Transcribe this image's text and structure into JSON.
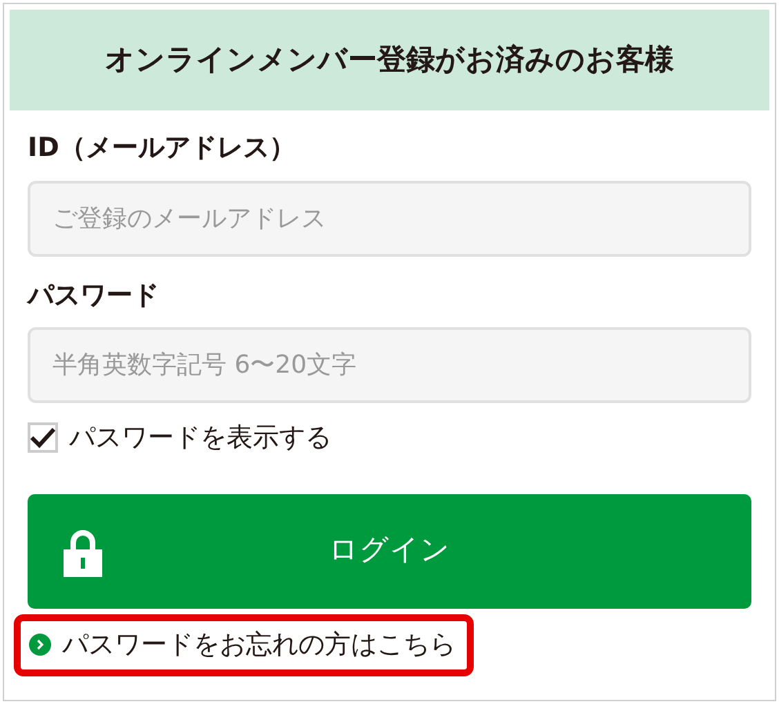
{
  "header": {
    "title": "オンラインメンバー登録がお済みのお客様"
  },
  "fields": [
    {
      "label": "ID（メールアドレス）",
      "placeholder": "ご登録のメールアドレス"
    },
    {
      "label": "パスワード",
      "placeholder": "半角英数字記号 6〜20文字"
    }
  ],
  "show_password": {
    "label": "パスワードを表示する",
    "checked": true
  },
  "login_button": {
    "label": "ログイン"
  },
  "forgot_link": {
    "label": "パスワードをお忘れの方はこちら",
    "highlighted": true
  }
}
